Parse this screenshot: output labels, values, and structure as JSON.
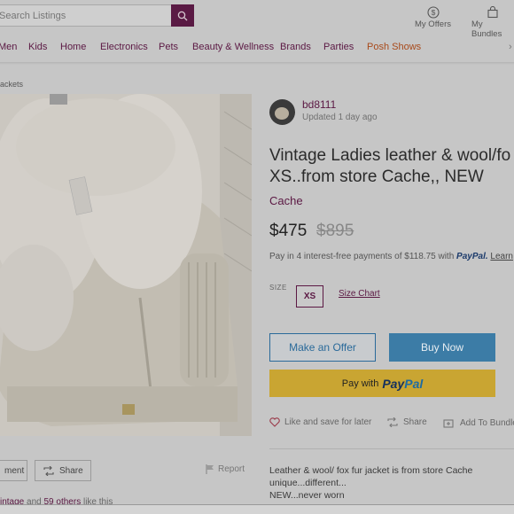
{
  "header": {
    "search_placeholder": "Search Listings",
    "my_offers_label": "My Offers",
    "my_bundles_label": "My Bundles"
  },
  "nav": {
    "items": [
      "Men",
      "Kids",
      "Home",
      "Electronics",
      "Pets",
      "Beauty & Wellness",
      "Brands",
      "Parties",
      "Posh Shows"
    ]
  },
  "breadcrumb": "ackets",
  "seller": {
    "name": "bd8111",
    "updated": "Updated 1 day ago"
  },
  "listing": {
    "title_line1": "Vintage Ladies leather & wool/fo",
    "title_line2": "XS..from store Cache,, NEW",
    "brand": "Cache",
    "price": "$475",
    "original_price": "$895",
    "paypal_note_prefix": "Pay in 4 interest-free payments of $118.75 with",
    "paypal_word": "PayPal.",
    "paypal_learn": "Learn",
    "size_label": "SIZE",
    "size_value": "XS",
    "size_chart_label": "Size Chart"
  },
  "buttons": {
    "offer": "Make an Offer",
    "buy": "Buy Now",
    "paypal_prefix": "Pay with",
    "paypal_pay": "Pay",
    "paypal_pal": "Pal"
  },
  "actions": {
    "like": "Like and save for later",
    "share": "Share",
    "bundle": "Add To Bundle"
  },
  "description": {
    "line1": "Leather & wool/ fox fur jacket is from store Cache",
    "line2": "unique...different...",
    "line3": "NEW...never worn"
  },
  "below_photo": {
    "comment_label": "ment",
    "share_label": "Share",
    "report_label": "Report",
    "likes_user": "intage",
    "likes_and": "and",
    "likes_others": "59 others",
    "likes_suffix": "like this"
  },
  "colors": {
    "brand_purple": "#5b1843",
    "buy_blue": "#3c7ca6",
    "paypal_yellow": "#c9a532",
    "posh_orange": "#a84a1b"
  }
}
